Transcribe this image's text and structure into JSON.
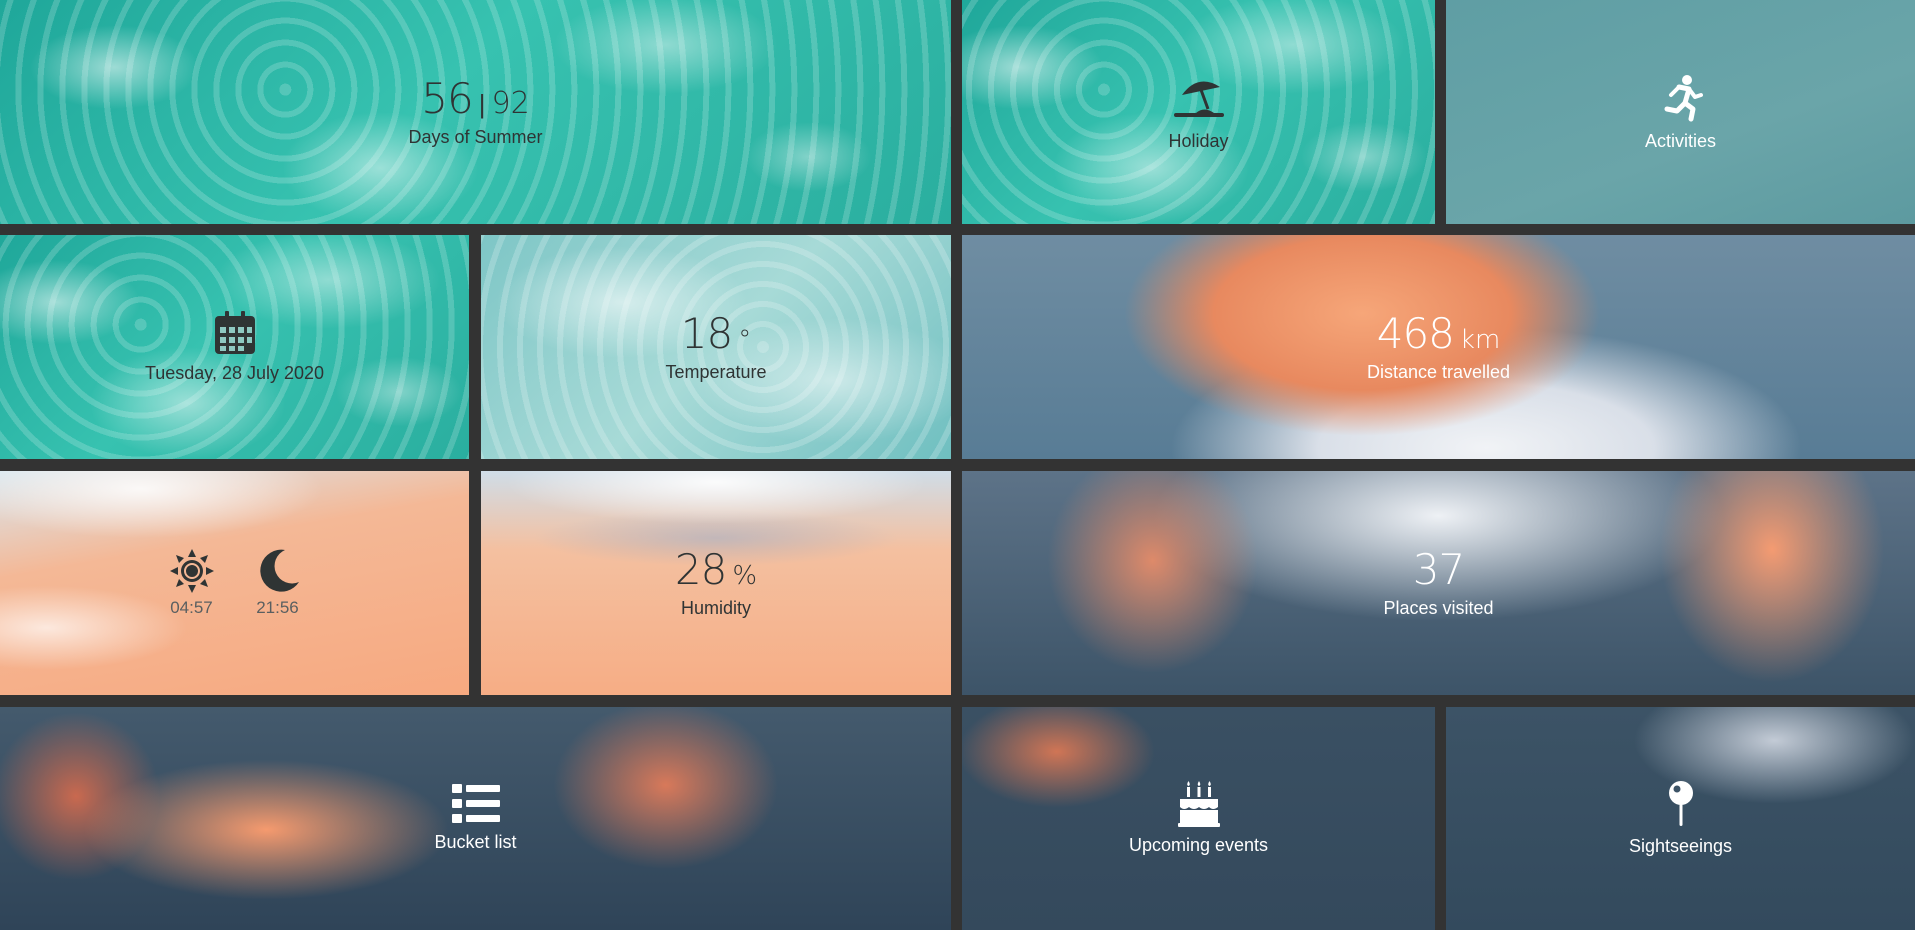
{
  "tiles": {
    "summer": {
      "value": "56",
      "total": "92",
      "label": "Days of Summer"
    },
    "holiday": {
      "icon": "beach-umbrella-icon",
      "label": "Holiday"
    },
    "activities": {
      "icon": "running-person-icon",
      "label": "Activities"
    },
    "date": {
      "icon": "calendar-icon",
      "label": "Tuesday, 28 July 2020"
    },
    "temperature": {
      "value": "18",
      "unit": "°",
      "label": "Temperature"
    },
    "distance": {
      "value": "468",
      "unit": "km",
      "label": "Distance travelled"
    },
    "sun": {
      "sunrise_icon": "sun-icon",
      "sunrise": "04:57",
      "sunset_icon": "moon-icon",
      "sunset": "21:56"
    },
    "humidity": {
      "value": "28",
      "unit": "%",
      "label": "Humidity"
    },
    "places": {
      "value": "37",
      "label": "Places visited"
    },
    "bucket": {
      "icon": "list-icon",
      "label": "Bucket list"
    },
    "events": {
      "icon": "cake-icon",
      "label": "Upcoming events"
    },
    "sightseeing": {
      "icon": "map-pin-icon",
      "label": "Sightseeings"
    }
  }
}
